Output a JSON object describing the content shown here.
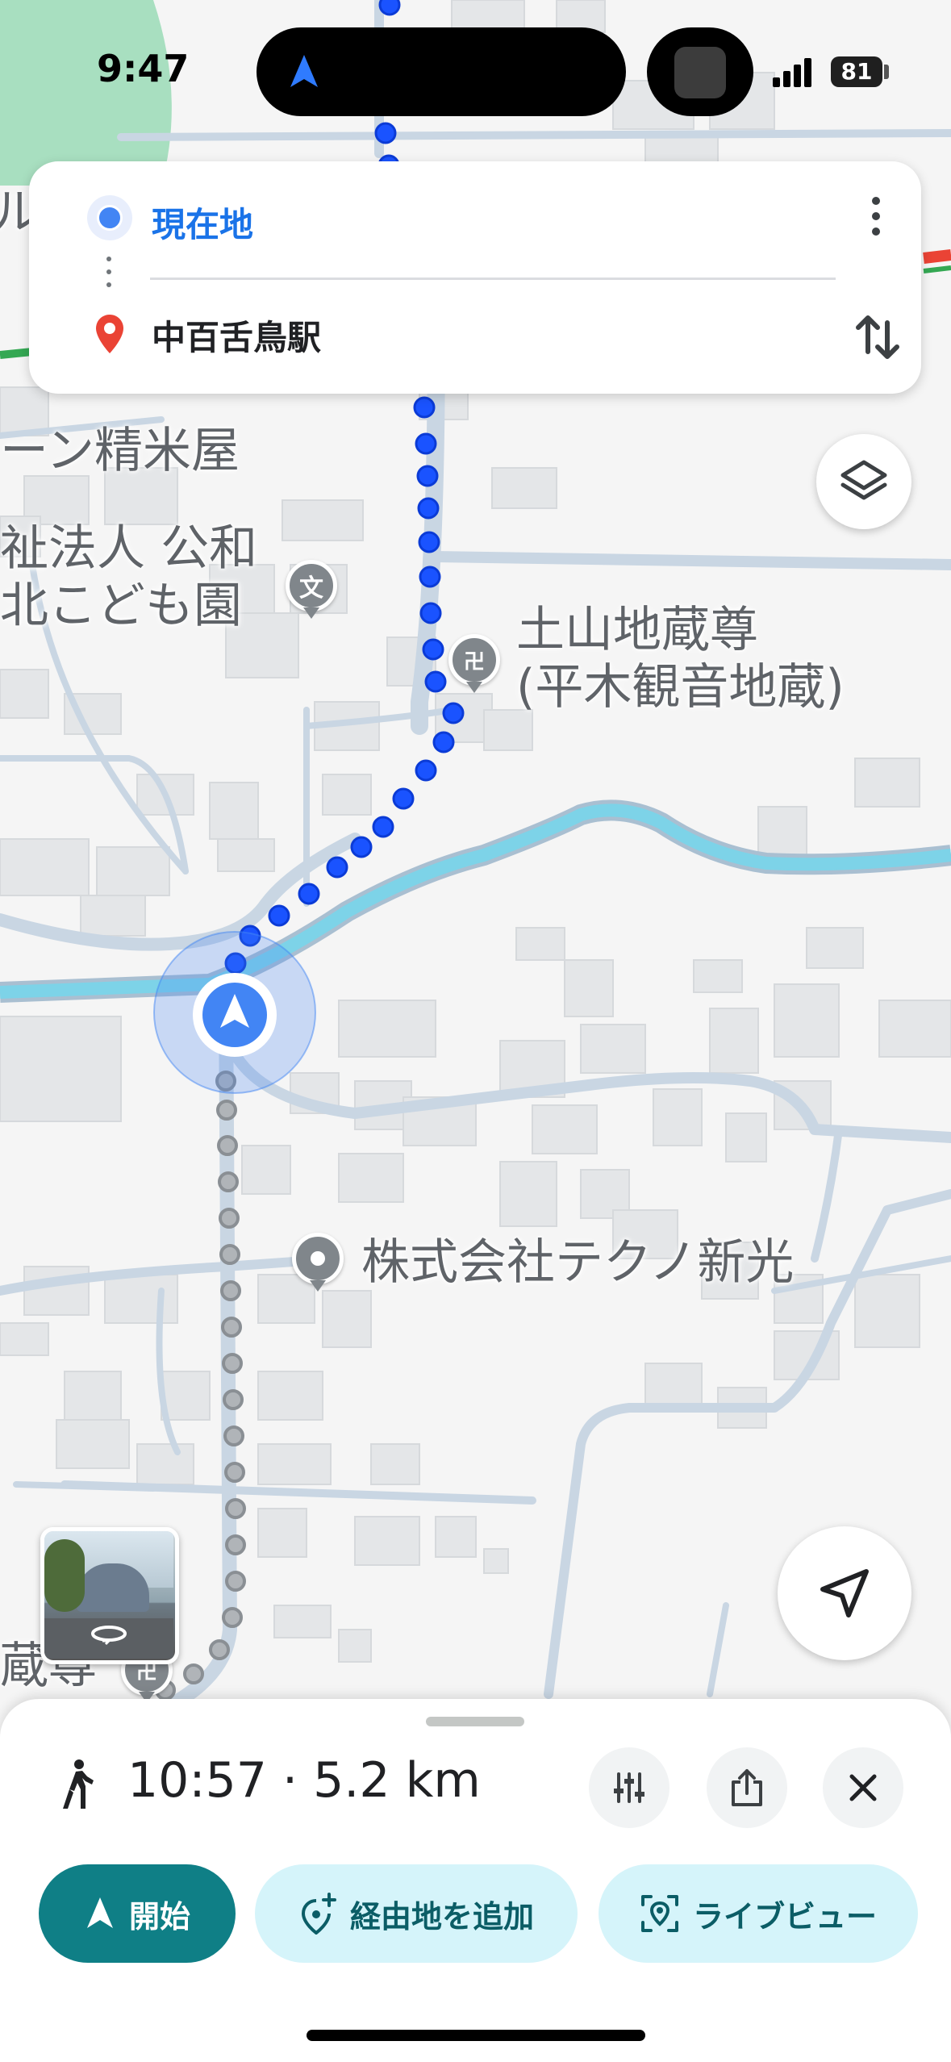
{
  "status_bar": {
    "time": "9:47",
    "battery": "81"
  },
  "route_card": {
    "origin": "現在地",
    "destination": "中百舌鳥駅"
  },
  "map": {
    "labels": {
      "partial_top": "ル 柿",
      "rice_shop": "ーン精米屋",
      "kindergarten": "祉法人 公和\n北こども園",
      "jizo": "土山地蔵尊\n(平木観音地蔵)",
      "company": "株式会社テクノ新光",
      "partial_bottom": "蔵尊"
    },
    "colors": {
      "route_active": "#1a53ff",
      "route_walked": "#9aa0a6",
      "river": "#7dd3e8",
      "road": "#c9d6e3",
      "building": "#e4e6e8",
      "park": "#a8dfc0"
    }
  },
  "bottom_sheet": {
    "trip_summary": "10:57 · 5.2 km",
    "start_label": "開始",
    "add_stop_label": "経由地を追加",
    "live_view_label": "ライブビュー"
  },
  "icons": {
    "walk": "walking-person-icon",
    "layers": "layers-icon",
    "recenter": "navigation-arrow-icon",
    "filters": "sliders-icon",
    "share": "share-icon",
    "close": "close-icon"
  }
}
